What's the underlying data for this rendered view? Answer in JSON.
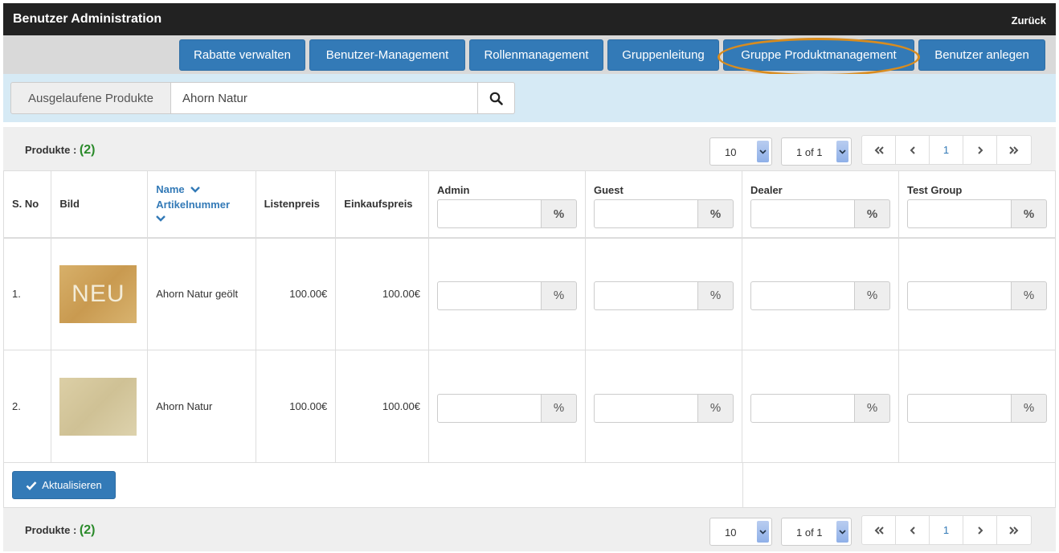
{
  "header": {
    "title": "Benutzer Administration",
    "back_label": "Zurück"
  },
  "nav": [
    {
      "label": "Rabatte verwalten"
    },
    {
      "label": "Benutzer-Management"
    },
    {
      "label": "Rollenmanagement"
    },
    {
      "label": "Gruppenleitung"
    },
    {
      "label": "Gruppe Produktmanagement",
      "highlighted": true
    },
    {
      "label": "Benutzer anlegen"
    }
  ],
  "search": {
    "addon_label": "Ausgelaufene Produkte",
    "value": "Ahorn Natur",
    "icon": "search-icon"
  },
  "pager": {
    "count_label": "Produkte :",
    "count_value": "(2)",
    "page_size": "10",
    "page_of": "1 of 1",
    "current_page": "1"
  },
  "table": {
    "headers": {
      "sno": "S. No",
      "image": "Bild",
      "name": "Name",
      "article": "Artikelnummer",
      "list_price": "Listenpreis",
      "purchase_price": "Einkaufspreis"
    },
    "groups": [
      "Admin",
      "Guest",
      "Dealer",
      "Test Group"
    ],
    "percent_symbol": "%",
    "rows": [
      {
        "sno": "1.",
        "image_text": "NEU",
        "name": "Ahorn Natur geölt",
        "list_price": "100.00€",
        "purchase_price": "100.00€"
      },
      {
        "sno": "2.",
        "image_text": "",
        "name": "Ahorn Natur",
        "list_price": "100.00€",
        "purchase_price": "100.00€"
      }
    ]
  },
  "update_button": {
    "label": "Aktualisieren"
  },
  "colors": {
    "primary": "#337ab7",
    "header_bg": "#222222",
    "search_bg": "#d6eaf5",
    "highlight": "#d98c1e",
    "count": "#2a8a2a"
  }
}
